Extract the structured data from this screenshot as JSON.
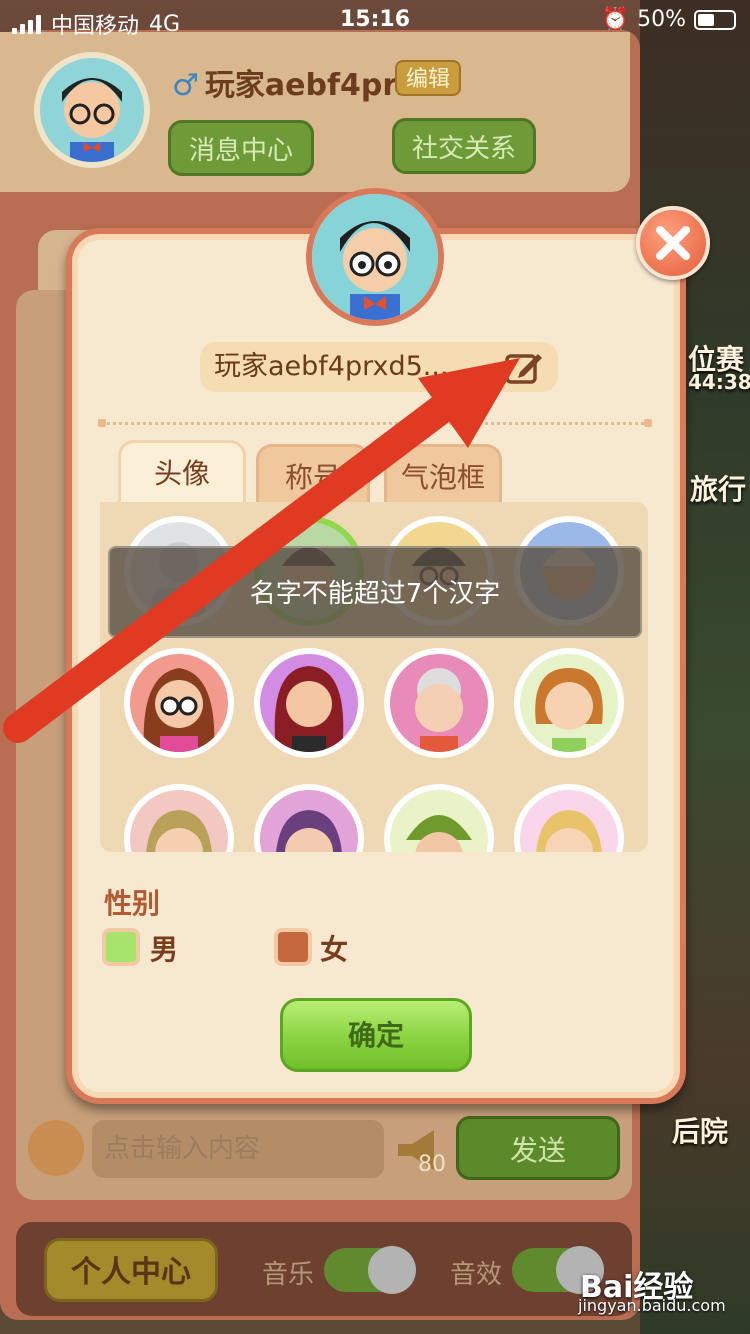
{
  "status_bar": {
    "carrier": "中国移动",
    "network": "4G",
    "time": "15:16",
    "battery": "50%"
  },
  "background": {
    "side_label_1": "位赛",
    "side_timer": "44:38",
    "side_label_2": "旅行",
    "side_label_3": "后院"
  },
  "profile": {
    "name": "玩家aebf4prx",
    "edit_label": "编辑",
    "message_center": "消息中心",
    "social": "社交关系"
  },
  "chat": {
    "placeholder": "点击输入内容",
    "horn_count": "80",
    "send_label": "发送"
  },
  "bottom": {
    "personal_center": "个人中心",
    "music": "音乐",
    "sound": "音效"
  },
  "dialog": {
    "name_value": "玩家aebf4prxd5...",
    "tabs": [
      "头像",
      "称号",
      "气泡框"
    ],
    "toast": "名字不能超过7个汉字",
    "gender_title": "性别",
    "male": "男",
    "female": "女",
    "confirm": "确定"
  },
  "colors": {
    "accent_green": "#86d13d",
    "arrow_red": "#e03a22",
    "dialog_border": "#d9795a"
  },
  "watermark": {
    "brand": "Bai经验",
    "url": "jingyan.baidu.com"
  }
}
